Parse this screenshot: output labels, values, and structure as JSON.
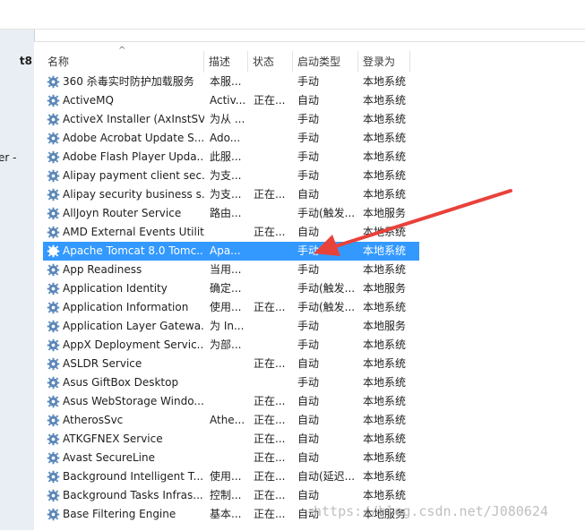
{
  "left_panel": {
    "text_1": "t8",
    "text_2": "er -"
  },
  "columns": {
    "name": "名称",
    "description": "描述",
    "status": "状态",
    "startup_type": "启动类型",
    "log_on_as": "登录为"
  },
  "sort_indicator": "^",
  "services": [
    {
      "name": "360 杀毒实时防护加载服务",
      "description": "本服...",
      "status": "",
      "startup_type": "手动",
      "log_on_as": "本地系统"
    },
    {
      "name": "ActiveMQ",
      "description": "Activ...",
      "status": "正在...",
      "startup_type": "自动",
      "log_on_as": "本地系统"
    },
    {
      "name": "ActiveX Installer (AxInstSV)",
      "description": "为从 ...",
      "status": "",
      "startup_type": "手动",
      "log_on_as": "本地系统"
    },
    {
      "name": "Adobe Acrobat Update S...",
      "description": "Ado...",
      "status": "",
      "startup_type": "手动",
      "log_on_as": "本地系统"
    },
    {
      "name": "Adobe Flash Player Upda...",
      "description": "此服...",
      "status": "",
      "startup_type": "手动",
      "log_on_as": "本地系统"
    },
    {
      "name": "Alipay payment client sec...",
      "description": "为支...",
      "status": "",
      "startup_type": "手动",
      "log_on_as": "本地系统"
    },
    {
      "name": "Alipay security business s...",
      "description": "为支...",
      "status": "正在...",
      "startup_type": "自动",
      "log_on_as": "本地系统"
    },
    {
      "name": "AllJoyn Router Service",
      "description": "路由...",
      "status": "",
      "startup_type": "手动(触发...",
      "log_on_as": "本地服务"
    },
    {
      "name": "AMD External Events Utility",
      "description": "",
      "status": "正在...",
      "startup_type": "自动",
      "log_on_as": "本地系统"
    },
    {
      "name": "Apache Tomcat 8.0 Tomc...",
      "description": "Apa...",
      "status": "",
      "startup_type": "手动",
      "log_on_as": "本地系统"
    },
    {
      "name": "App Readiness",
      "description": "当用...",
      "status": "",
      "startup_type": "手动",
      "log_on_as": "本地系统"
    },
    {
      "name": "Application Identity",
      "description": "确定...",
      "status": "",
      "startup_type": "手动(触发...",
      "log_on_as": "本地服务"
    },
    {
      "name": "Application Information",
      "description": "使用...",
      "status": "正在...",
      "startup_type": "手动(触发...",
      "log_on_as": "本地系统"
    },
    {
      "name": "Application Layer Gatewa...",
      "description": "为 In...",
      "status": "",
      "startup_type": "手动",
      "log_on_as": "本地服务"
    },
    {
      "name": "AppX Deployment Servic...",
      "description": "为部...",
      "status": "",
      "startup_type": "手动",
      "log_on_as": "本地系统"
    },
    {
      "name": "ASLDR Service",
      "description": "",
      "status": "正在...",
      "startup_type": "自动",
      "log_on_as": "本地系统"
    },
    {
      "name": "Asus GiftBox Desktop",
      "description": "",
      "status": "",
      "startup_type": "手动",
      "log_on_as": "本地系统"
    },
    {
      "name": "Asus WebStorage Windo...",
      "description": "",
      "status": "正在...",
      "startup_type": "自动",
      "log_on_as": "本地系统"
    },
    {
      "name": "AtherosSvc",
      "description": "Athe...",
      "status": "正在...",
      "startup_type": "自动",
      "log_on_as": "本地系统"
    },
    {
      "name": "ATKGFNEX Service",
      "description": "",
      "status": "正在...",
      "startup_type": "自动",
      "log_on_as": "本地系统"
    },
    {
      "name": "Avast SecureLine",
      "description": "",
      "status": "正在...",
      "startup_type": "自动",
      "log_on_as": "本地系统"
    },
    {
      "name": "Background Intelligent T...",
      "description": "使用...",
      "status": "正在...",
      "startup_type": "自动(延迟...",
      "log_on_as": "本地系统"
    },
    {
      "name": "Background Tasks Infras...",
      "description": "控制...",
      "status": "正在...",
      "startup_type": "自动",
      "log_on_as": "本地系统"
    },
    {
      "name": "Base Filtering Engine",
      "description": "基本...",
      "status": "正在...",
      "startup_type": "自动",
      "log_on_as": "本地服务"
    }
  ],
  "selected_row": 9,
  "colors": {
    "selection": "#3399ff",
    "arrow": "#e8423b",
    "gear": "#5a87b8"
  },
  "icons": {
    "service": "gear-icon",
    "annotation": "red-arrow-annotation"
  },
  "watermark": "https://blog.csdn.net/J080624"
}
